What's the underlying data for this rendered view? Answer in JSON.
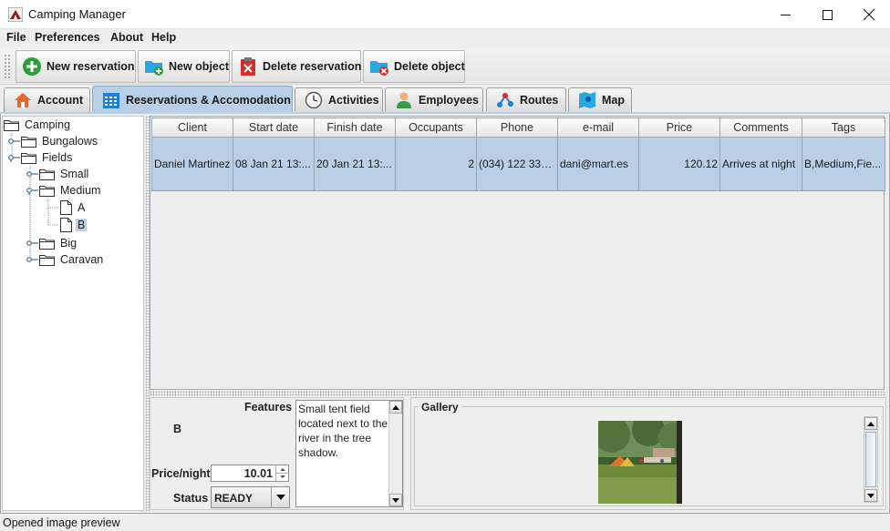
{
  "window": {
    "title": "Camping Manager",
    "icon": "camping-app-icon"
  },
  "menu": {
    "items": [
      "File",
      "Preferences",
      "About",
      "Help"
    ]
  },
  "toolbar": {
    "buttons": [
      {
        "label": "New reservation",
        "icon": "plus-circle-icon"
      },
      {
        "label": "New object",
        "icon": "new-folder-icon"
      },
      {
        "label": "Delete reservation",
        "icon": "delete-clipboard-icon"
      },
      {
        "label": "Delete object",
        "icon": "delete-folder-icon"
      }
    ]
  },
  "tabs": [
    {
      "label": "Account",
      "icon": "home-icon"
    },
    {
      "label": "Reservations & Accomodation",
      "icon": "calendar-icon",
      "active": true
    },
    {
      "label": "Activities",
      "icon": "clock-icon"
    },
    {
      "label": "Employees",
      "icon": "person-icon"
    },
    {
      "label": "Routes",
      "icon": "route-icon"
    },
    {
      "label": "Map",
      "icon": "map-icon"
    }
  ],
  "tree": {
    "root": "Camping",
    "nodes": [
      "Bungalows",
      "Fields",
      "Small",
      "Medium",
      "A",
      "B",
      "Big",
      "Caravan"
    ],
    "selected": "B"
  },
  "table": {
    "columns": [
      "Client",
      "Start date",
      "Finish date",
      "Occupants",
      "Phone",
      "e-mail",
      "Price",
      "Comments",
      "Tags"
    ],
    "rows": [
      [
        "Daniel Martinez",
        "08 Jan 21 13:...",
        "20 Jan 21 13:...",
        "2",
        "(034) 122 332...",
        "dani@mart.es",
        "120.12",
        "Arrives at night",
        "B,Medium,Fie..."
      ]
    ]
  },
  "details": {
    "features_label": "Features",
    "name": "B",
    "description": "Small tent field located next to the river in the tree shadow.",
    "price_label": "Price/night",
    "price_value": "10.01",
    "status_label": "Status",
    "status_value": "READY"
  },
  "gallery": {
    "title": "Gallery"
  },
  "statusbar": {
    "text": "Opened image preview"
  },
  "colors": {
    "selection": "#b8cfe5",
    "background": "#eeeeee"
  }
}
